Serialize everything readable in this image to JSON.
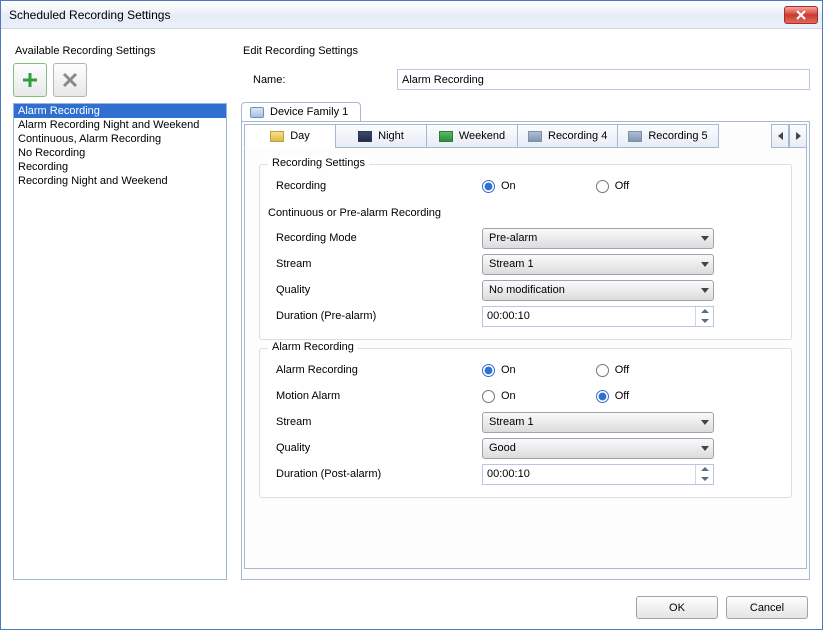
{
  "window": {
    "title": "Scheduled Recording Settings"
  },
  "left": {
    "heading": "Available Recording Settings",
    "items": [
      "Alarm Recording",
      "Alarm Recording Night and Weekend",
      "Continuous, Alarm Recording",
      "No Recording",
      "Recording",
      "Recording Night and Weekend"
    ],
    "selected_index": 0
  },
  "edit": {
    "heading": "Edit Recording Settings",
    "name_label": "Name:",
    "name_value": "Alarm Recording",
    "device_tab": "Device Family 1",
    "rec_tabs": [
      "Day",
      "Night",
      "Weekend",
      "Recording 4",
      "Recording 5"
    ],
    "rec_tab_active": 0
  },
  "grp1": {
    "legend": "Recording Settings",
    "recording_label": "Recording",
    "recording_value": "On",
    "sub_legend": "Continuous or Pre-alarm Recording",
    "mode_label": "Recording Mode",
    "mode_value": "Pre-alarm",
    "stream_label": "Stream",
    "stream_value": "Stream 1",
    "quality_label": "Quality",
    "quality_value": "No modification",
    "duration_label": "Duration (Pre-alarm)",
    "duration_value": "00:00:10"
  },
  "grp2": {
    "legend": "Alarm Recording",
    "ar_label": "Alarm Recording",
    "ar_value": "On",
    "ma_label": "Motion Alarm",
    "ma_value": "Off",
    "stream_label": "Stream",
    "stream_value": "Stream 1",
    "quality_label": "Quality",
    "quality_value": "Good",
    "duration_label": "Duration (Post-alarm)",
    "duration_value": "00:00:10"
  },
  "radio": {
    "on": "On",
    "off": "Off"
  },
  "footer": {
    "ok": "OK",
    "cancel": "Cancel"
  }
}
